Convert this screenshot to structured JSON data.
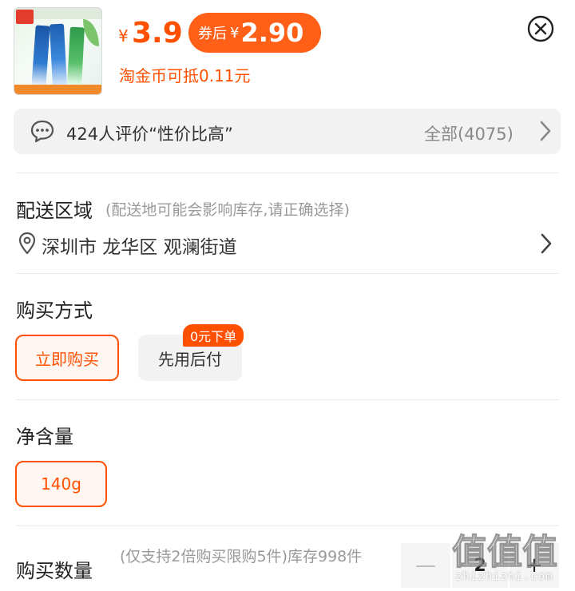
{
  "header": {
    "price_symbol": "¥",
    "price": "3.9",
    "coupon_label": "券后",
    "coupon_symbol": "¥",
    "coupon_price": "2.90",
    "coin_text": "淘金币可抵0.11元",
    "close_icon": "close-circle-icon"
  },
  "review": {
    "text": "424人评价“性价比高”",
    "all_label": "全部(4075)",
    "chat_icon": "chat-bubble-icon",
    "arrow_icon": "chevron-right-icon"
  },
  "delivery": {
    "title": "配送区域",
    "note": "(配送地可能会影响库存,请正确选择)",
    "address": "深圳市 龙华区 观澜街道",
    "pin_icon": "location-pin-icon"
  },
  "purchase_method": {
    "title": "购买方式",
    "options": [
      {
        "label": "立即购买",
        "selected": true
      },
      {
        "label": "先用后付",
        "selected": false,
        "badge": "0元下单"
      }
    ]
  },
  "net_content": {
    "title": "净含量",
    "options": [
      {
        "label": "140g",
        "selected": true
      }
    ]
  },
  "quantity": {
    "title": "购买数量",
    "note": "(仅支持2倍购买限购5件)库存998件",
    "minus": "—",
    "value": "2",
    "plus": "+"
  },
  "watermark": {
    "logo": "值值值",
    "domain": "zhizhizhi.com"
  },
  "colors": {
    "accent": "#ff5000",
    "coupon_bg": "#ff5f16",
    "muted_text": "#999999",
    "panel_bg": "#f2f2f2"
  }
}
